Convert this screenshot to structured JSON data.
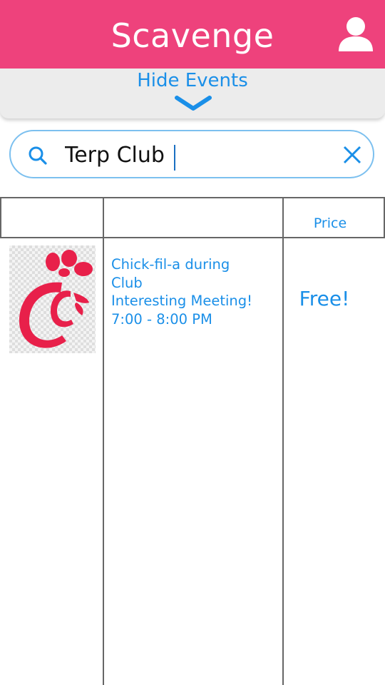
{
  "header": {
    "title": "Scavenge",
    "profile_icon": "person-icon"
  },
  "hide_events": {
    "label": "Hide Events",
    "icon": "chevron-down-icon"
  },
  "search": {
    "value": "Terp Club",
    "search_icon": "search-icon",
    "clear_icon": "close-icon"
  },
  "table": {
    "columns": [
      "",
      "",
      "Price"
    ],
    "rows": [
      {
        "image": "chick-fil-a-logo",
        "title_line1": "Chick-fil-a during",
        "title_line2": "Club",
        "subtitle": "Interesting Meeting!",
        "time": "7:00 - 8:00 PM",
        "price": "Free!"
      }
    ]
  },
  "colors": {
    "header_bg": "#ee427c",
    "accent_blue": "#1a8fe8",
    "logo_red": "#e8204a",
    "bar_bg": "#ececec"
  }
}
